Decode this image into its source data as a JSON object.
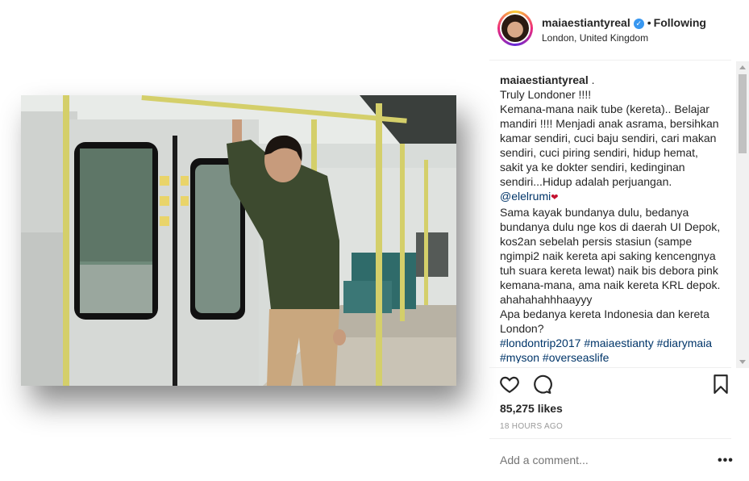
{
  "post": {
    "username": "maiaestiantyreal",
    "verified_badge": "✓",
    "separator": "•",
    "follow_status": "Following",
    "location": "London, United Kingdom"
  },
  "caption": {
    "author": "maiaestiantyreal",
    "author_suffix": " .",
    "lines": [
      "Truly Londoner !!!!",
      "Kemana-mana naik tube (kereta).. Belajar",
      "mandiri !!!! Menjadi anak asrama, bersihkan",
      "kamar sendiri, cuci baju sendiri, cari makan",
      "sendiri, cuci piring sendiri, hidup hemat,",
      "sakit ya ke dokter sendiri, kedinginan",
      "sendiri...Hidup adalah perjuangan."
    ],
    "mention": "@elelrumi",
    "mention_emoji": "❤",
    "lines2": [
      "Sama kayak bundanya dulu, bedanya",
      "bundanya dulu nge kos di daerah UI Depok,",
      "kos2an sebelah persis stasiun (sampe",
      "ngimpi2 naik kereta api saking kencengnya",
      "tuh suara kereta lewat) naik bis debora pink",
      "kemana-mana, ama naik kereta KRL depok.",
      "ahahahahhhaayyy",
      "Apa bedanya kereta Indonesia dan kereta",
      "London?"
    ],
    "hashtags_line1": [
      "#londontrip2017",
      "#maiaestianty",
      "#diarymaia"
    ],
    "hashtags_line2": [
      "#myson",
      "#overseaslife"
    ]
  },
  "actions": {
    "like_icon": "heart-icon",
    "comment_icon": "comment-icon",
    "save_icon": "bookmark-icon"
  },
  "likes": "85,275 likes",
  "timestamp": "18 HOURS AGO",
  "comment": {
    "placeholder": "Add a comment...",
    "more_label": "•••"
  },
  "colors": {
    "link": "#003569",
    "verified": "#3897f0",
    "muted": "#999999"
  }
}
